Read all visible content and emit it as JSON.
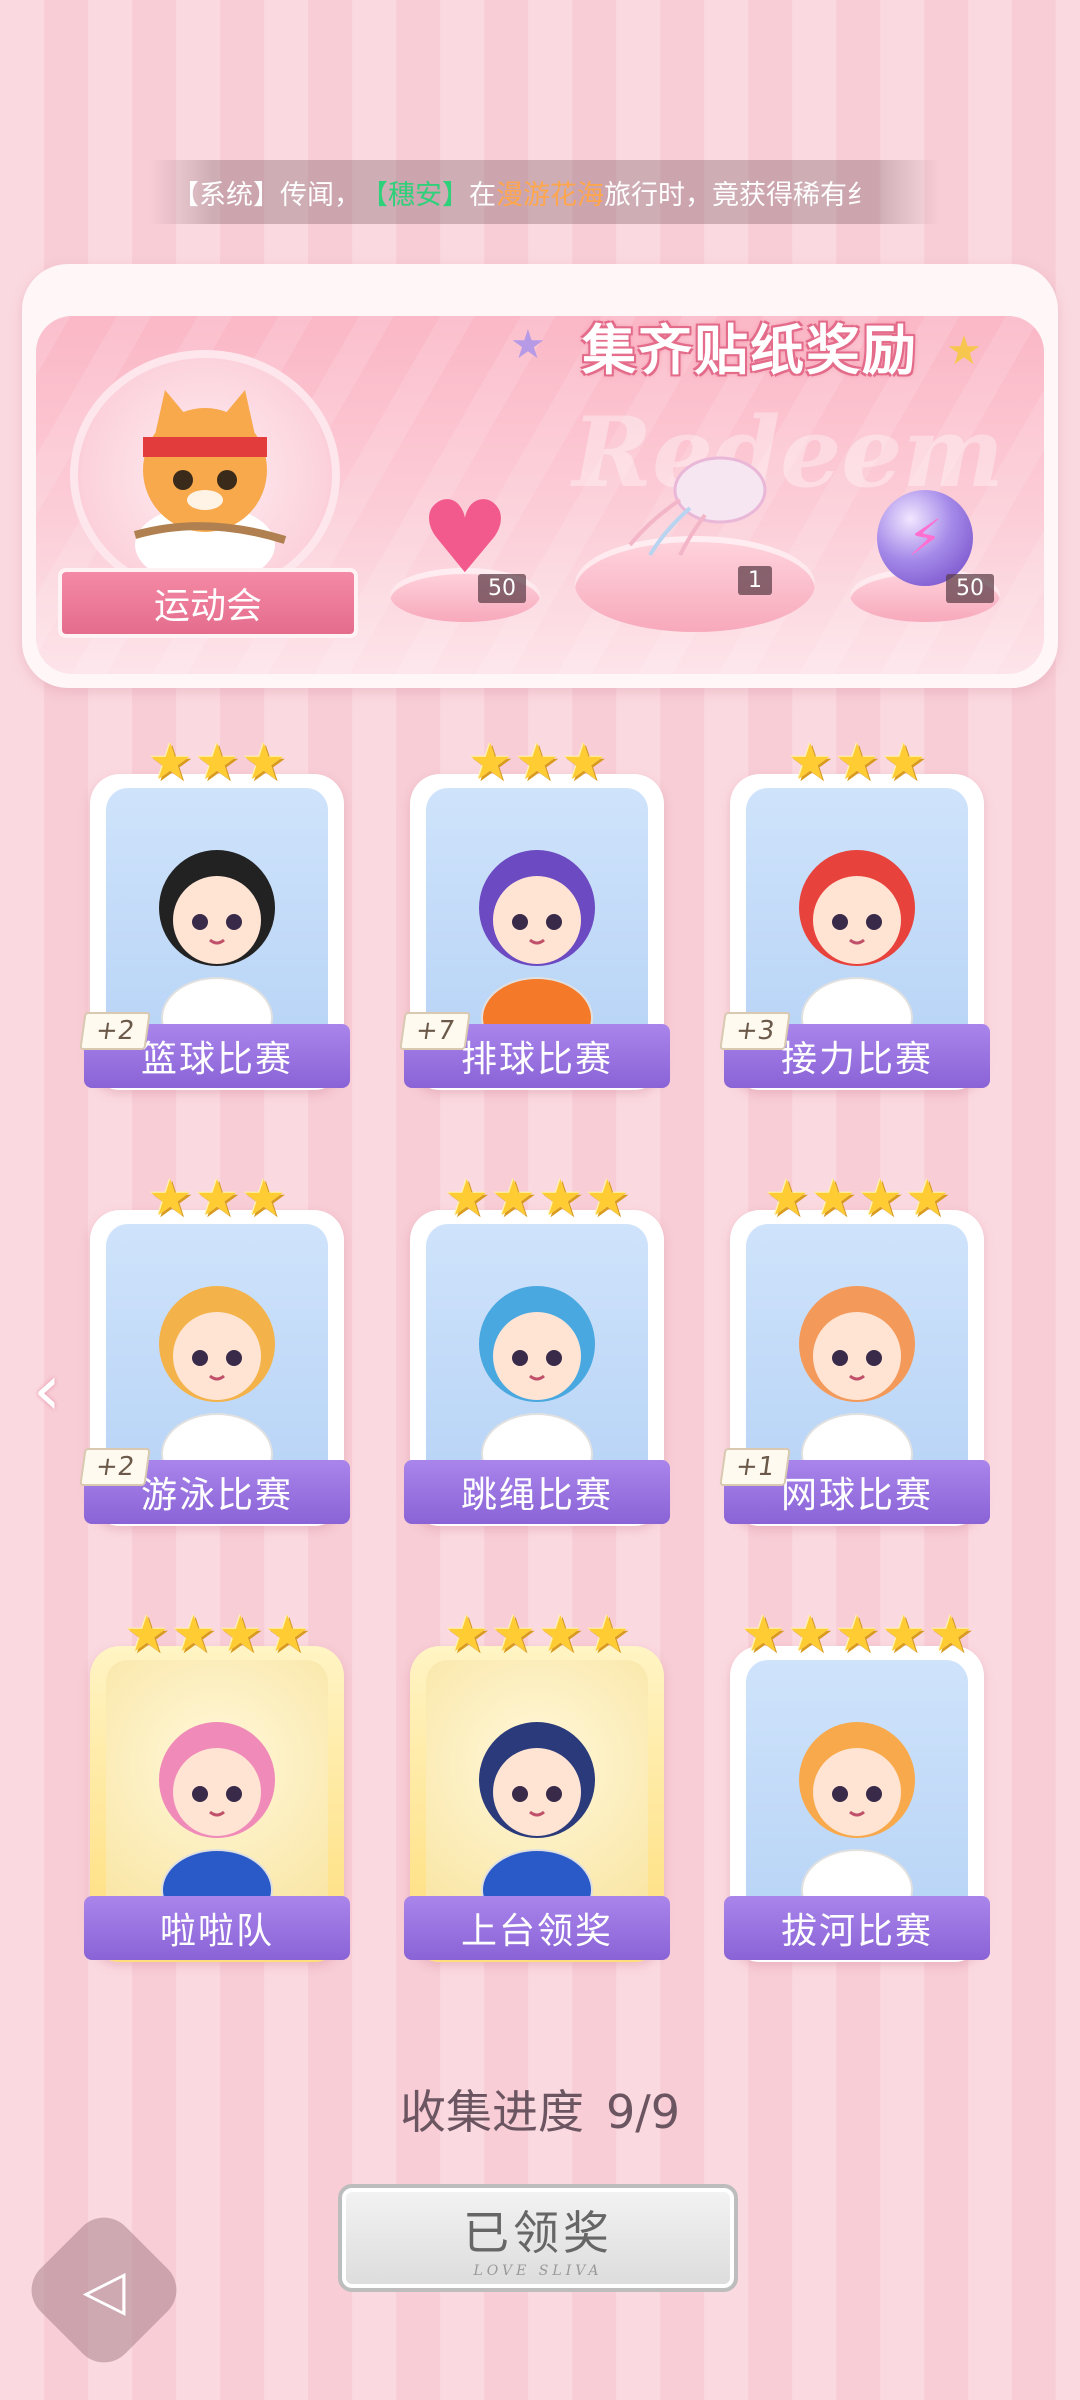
{
  "marquee": {
    "prefix": "【系统】传闻，",
    "player": "【穗安】",
    "mid": "在",
    "place": "漫游花海",
    "suffix": "旅行时，竟获得稀有纟"
  },
  "banner": {
    "title": "集齐贴纸奖励",
    "watermark": "Redeem",
    "theme_label": "运动会",
    "rewards": [
      {
        "icon": "heart-gem-icon",
        "count": "50"
      },
      {
        "icon": "jellyfish-icon",
        "count": "1"
      },
      {
        "icon": "lightning-orb-icon",
        "count": "50"
      }
    ]
  },
  "cards": [
    {
      "label": "篮球比赛",
      "stars": 3,
      "bonus": "+2"
    },
    {
      "label": "排球比赛",
      "stars": 3,
      "bonus": "+7"
    },
    {
      "label": "接力比赛",
      "stars": 3,
      "bonus": "+3"
    },
    {
      "label": "游泳比赛",
      "stars": 3,
      "bonus": "+2"
    },
    {
      "label": "跳绳比赛",
      "stars": 4,
      "bonus": ""
    },
    {
      "label": "网球比赛",
      "stars": 4,
      "bonus": "+1"
    },
    {
      "label": "啦啦队",
      "stars": 4,
      "bonus": ""
    },
    {
      "label": "上台领奖",
      "stars": 4,
      "bonus": ""
    },
    {
      "label": "拔河比赛",
      "stars": 5,
      "bonus": ""
    }
  ],
  "progress": {
    "label": "收集进度",
    "value": "9/9"
  },
  "claim_button": {
    "label": "已领奖",
    "sub": "LOVE SLIVA"
  },
  "colors": {
    "accent_purple": "#8a63d6",
    "star_gold": "#ffcc33",
    "banner_pink": "#fbb7c6"
  }
}
